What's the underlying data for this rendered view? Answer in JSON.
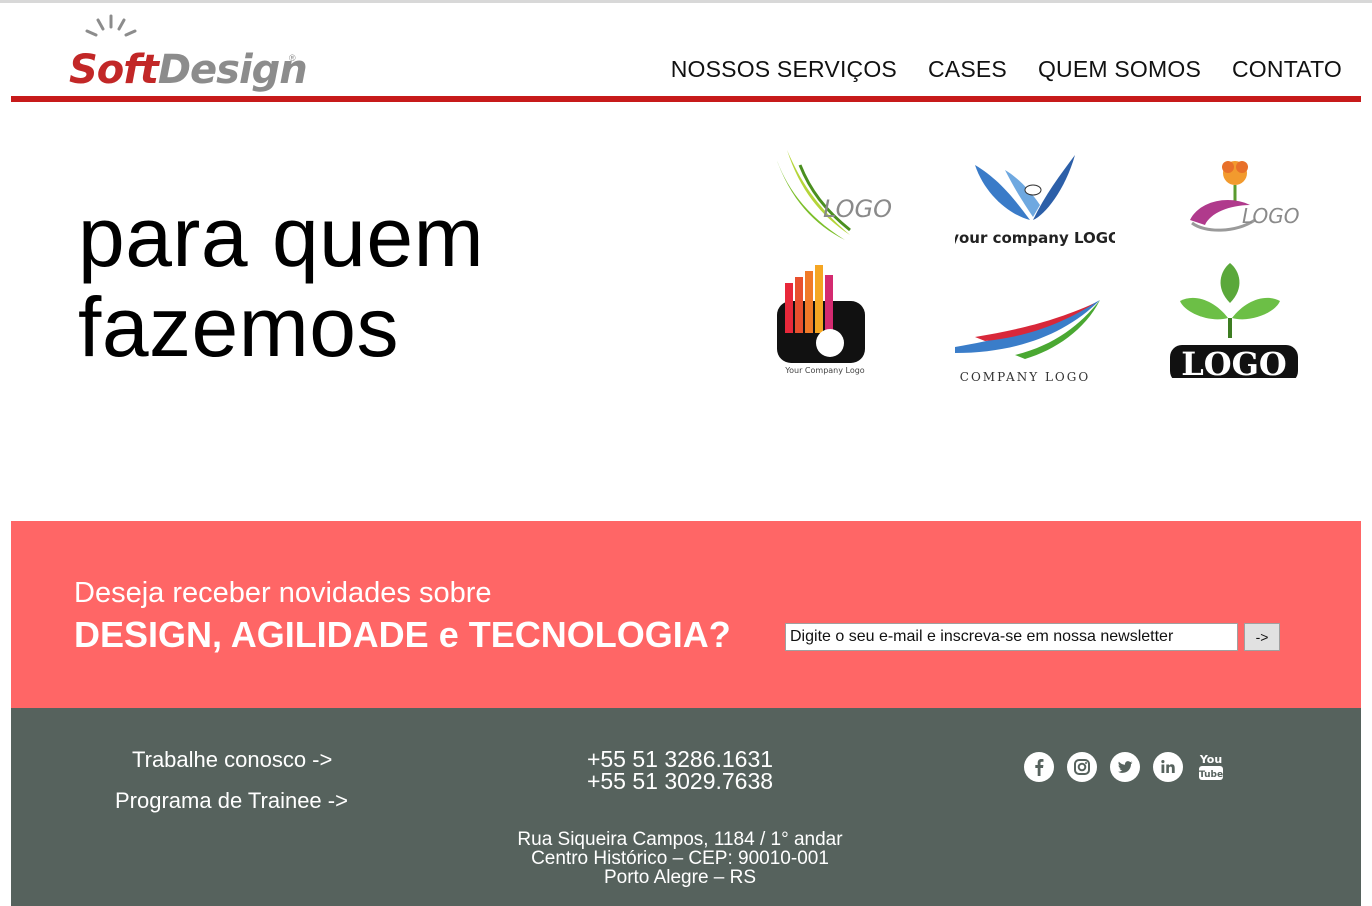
{
  "brand": {
    "name_part1": "Soft",
    "name_part2": "Design",
    "registered": "®",
    "color_red": "#c22727",
    "color_gray": "#8c8c8c"
  },
  "nav": {
    "items": [
      {
        "label": "NOSSOS SERVIÇOS"
      },
      {
        "label": "CASES"
      },
      {
        "label": "QUEM SOMOS"
      },
      {
        "label": "CONTATO"
      }
    ]
  },
  "hero": {
    "title_line1": "para quem",
    "title_line2": "fazemos",
    "client_logos": [
      {
        "icon": "leaf-logo-icon",
        "text": "LOGO"
      },
      {
        "icon": "company-logo-icon",
        "text": "your company LOGO"
      },
      {
        "icon": "flower-logo-icon",
        "text": "LOGO"
      },
      {
        "icon": "camera-logo-icon",
        "text": "Your Company Logo"
      },
      {
        "icon": "swoosh-logo-icon",
        "text": "COMPANY LOGO"
      },
      {
        "icon": "plant-logo-icon",
        "text": "LOGO"
      }
    ]
  },
  "newsletter": {
    "line1": "Deseja receber novidades sobre",
    "line2": "DESIGN, AGILIDADE e TECNOLOGIA?",
    "input_placeholder": "Digite o seu e-mail e inscreva-se em nossa newsletter",
    "button_label": "->",
    "background": "#ff6666"
  },
  "footer": {
    "work_link": "Trabalhe conosco ->",
    "trainee_link": "Programa de Trainee ->",
    "phone1": "+55 51 3286.1631",
    "phone2": "+55 51 3029.7638",
    "address_line1": "Rua Siqueira Campos, 1184 / 1° andar",
    "address_line2": "Centro Histórico – CEP: 90010-001",
    "address_line3": "Porto Alegre – RS",
    "social": [
      "facebook-icon",
      "instagram-icon",
      "twitter-icon",
      "linkedin-icon",
      "youtube-icon"
    ],
    "background": "#56625d"
  },
  "accent_red": "#c71a1a"
}
